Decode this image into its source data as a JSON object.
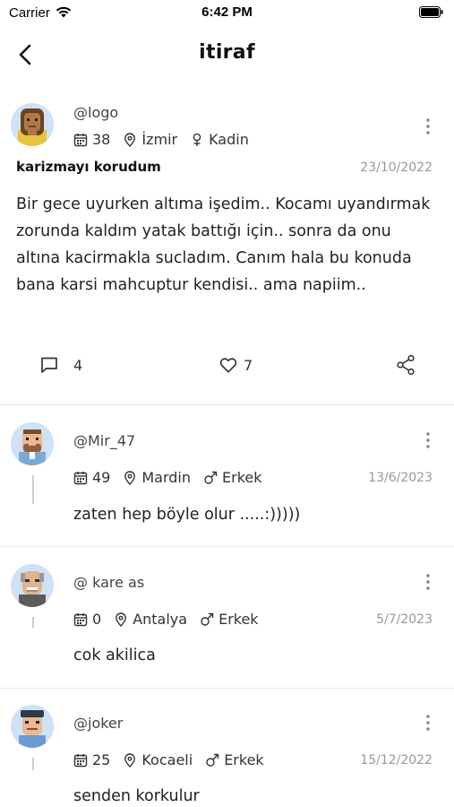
{
  "status_bar": {
    "carrier": "Carrier",
    "time": "6:42 PM"
  },
  "header": {
    "title": "itiraf"
  },
  "post": {
    "username": "@logo",
    "age": "38",
    "city": "İzmir",
    "gender": "Kadin",
    "title": "karizmayı korudum",
    "date": "23/10/2022",
    "body": "Bir gece uyurken altıma işedim.. Kocamı uyandırmak zorunda kaldım yatak battığı için.. sonra da onu altına kacirmakla sucladım. Canım hala bu konuda bana karsi mahcuptur kendisi.. ama napiim..",
    "comment_count": "4",
    "like_count": "7"
  },
  "comments": [
    {
      "username": "@Mir_47",
      "age": "49",
      "city": "Mardin",
      "gender": "Erkek",
      "date": "13/6/2023",
      "text": "zaten hep böyle olur .....:)))))"
    },
    {
      "username": "@ kare as",
      "age": "0",
      "city": "Antalya",
      "gender": "Erkek",
      "date": "5/7/2023",
      "text": "cok akilica"
    },
    {
      "username": "@joker",
      "age": "25",
      "city": "Kocaeli",
      "gender": "Erkek",
      "date": "15/12/2022",
      "text": "senden korkulur"
    }
  ],
  "icons": {
    "back": "chevron-left-icon",
    "more": "more-vertical-icon",
    "age": "calendar-icon",
    "city": "map-pin-icon",
    "female": "female-icon",
    "male": "male-icon",
    "comment": "message-square-icon",
    "like": "heart-icon",
    "share": "share-icon"
  }
}
